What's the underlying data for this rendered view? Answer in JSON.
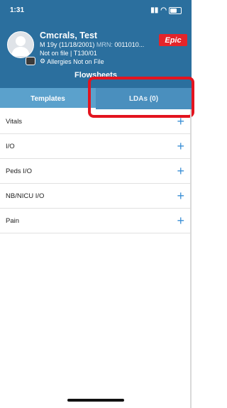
{
  "status_bar": {
    "time": "1:31",
    "signal": "signal-bars",
    "wifi": "wifi-icon",
    "battery": "battery-icon"
  },
  "patient": {
    "name": "Cmcrals, Test",
    "demographics": "M 19y (11/18/2001)",
    "mrn_label": "MRN:",
    "mrn_value": "0011010...",
    "coverage": "Not on file | T130/01",
    "allergies": "Allergies Not on File"
  },
  "brand": {
    "logo_text": "Epic",
    "color": "#e4242a"
  },
  "section_title": "Flowsheets",
  "tabs": [
    {
      "label": "Templates",
      "active": true
    },
    {
      "label": "LDAs (0)",
      "active": false
    }
  ],
  "flowsheet_items": [
    {
      "label": "Vitals"
    },
    {
      "label": "I/O"
    },
    {
      "label": "Peds I/O"
    },
    {
      "label": "NB/NICU I/O"
    },
    {
      "label": "Pain"
    }
  ],
  "add_symbol": "+",
  "colors": {
    "header": "#2b6f9e",
    "active_tab": "#5ba1cc",
    "inactive_tab": "#4a8fbe",
    "accent_plus": "#3a8fd6",
    "highlight": "#e3141f"
  }
}
